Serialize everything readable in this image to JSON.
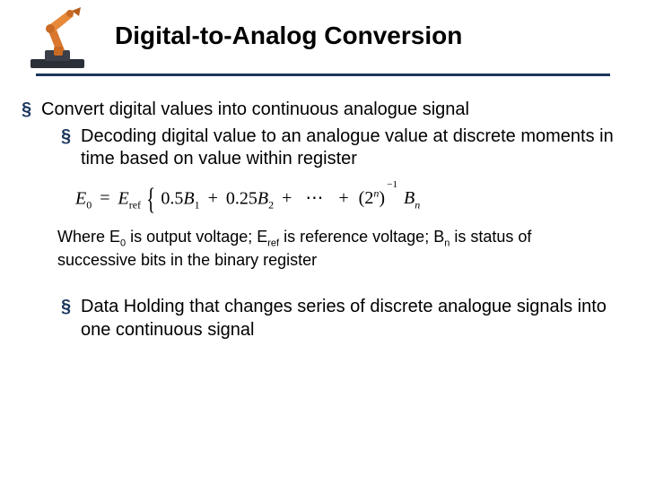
{
  "title": "Digital-to-Analog Conversion",
  "bullets": {
    "b1": "Convert digital values into continuous analogue signal",
    "b1_1": "Decoding digital value to an analogue value at discrete moments in time based on value within register",
    "b1_2": "Data Holding that changes series of discrete analogue signals into one continuous signal"
  },
  "formula": {
    "lhs_E": "E",
    "lhs_sub": "0",
    "eq": "=",
    "Eref_E": "E",
    "Eref_sub": "ref",
    "t1_coef": "0.5",
    "t1_B": "B",
    "t1_sub": "1",
    "plus": "+",
    "t2_coef": "0.25",
    "t2_B": "B",
    "t2_sub": "2",
    "dots": "⋯",
    "paren_open": "(",
    "two": "2",
    "n": "n",
    "paren_close": ")",
    "neg1": "−1",
    "tn_B": "B",
    "tn_sub": "n"
  },
  "where": {
    "pre": "Where E",
    "s0": "0",
    "p1": " is output voltage; E",
    "sref": "ref",
    "p2": " is reference voltage; B",
    "sn": "n",
    "p3": " is status of successive bits in the binary register"
  },
  "bullet_marker": "§"
}
